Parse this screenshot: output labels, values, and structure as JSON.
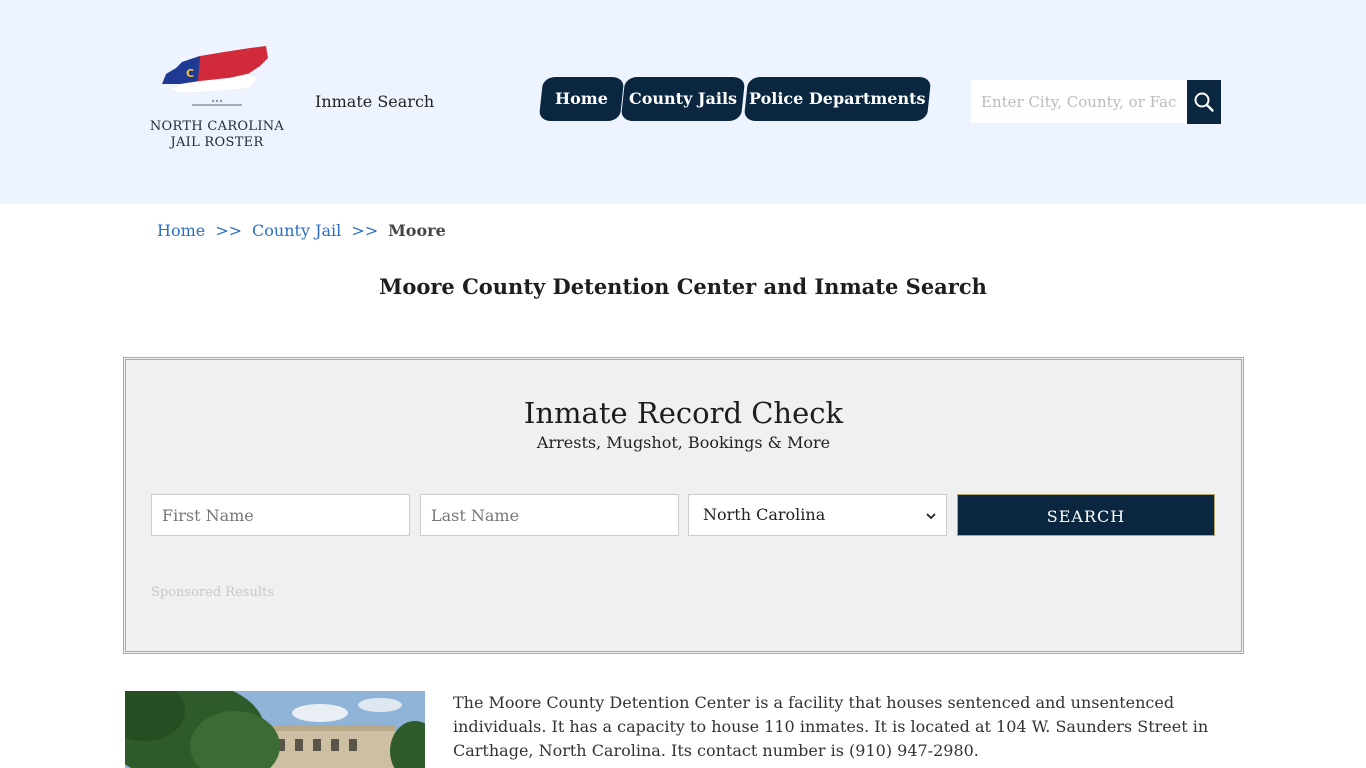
{
  "header": {
    "logo": {
      "line1": "NORTH CAROLINA",
      "line2": "JAIL ROSTER",
      "badge_letter": "C"
    },
    "inmate_search_link": "Inmate Search",
    "nav": [
      {
        "label": "Home"
      },
      {
        "label": "County Jails"
      },
      {
        "label": "Police Departments"
      }
    ],
    "search": {
      "placeholder": "Enter City, County, or Facility"
    },
    "colors": {
      "background": "#eef4ff",
      "nav": "#0b2740"
    }
  },
  "breadcrumb": {
    "home": "Home",
    "separator": ">>",
    "county_jail": "County Jail",
    "current": "Moore"
  },
  "page_title": "Moore County Detention Center and Inmate Search",
  "record_check": {
    "title": "Inmate Record Check",
    "subtitle": "Arrests, Mugshot, Bookings & More",
    "first_name_placeholder": "First Name",
    "last_name_placeholder": "Last Name",
    "state_selected": "North Carolina",
    "search_label": "SEARCH",
    "sponsored": "Sponsored Results"
  },
  "intro_text": "The Moore County Detention Center is a facility that houses sentenced and unsentenced individuals. It has a capacity to house 110 inmates. It is located at 104 W. Saunders Street in Carthage, North Carolina. Its contact number is (910) 947-2980."
}
